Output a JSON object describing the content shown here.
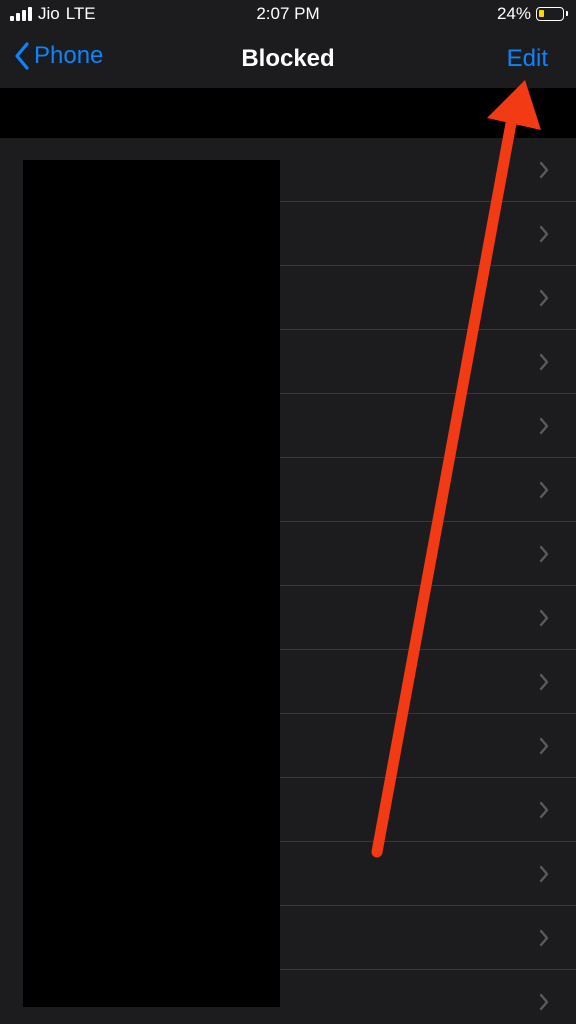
{
  "status_bar": {
    "carrier": "Jio",
    "network": "LTE",
    "time": "2:07 PM",
    "battery_percent": "24%",
    "battery_level": 0.24,
    "battery_color": "#ffd60a"
  },
  "nav": {
    "back_label": "Phone",
    "title": "Blocked",
    "edit_label": "Edit",
    "accent_color": "#0a84ff"
  },
  "list": {
    "rows": [
      {
        "label": ""
      },
      {
        "label": ""
      },
      {
        "label": ""
      },
      {
        "label": ""
      },
      {
        "label": ""
      },
      {
        "label": ""
      },
      {
        "label": ""
      },
      {
        "label": ""
      },
      {
        "label": ""
      },
      {
        "label": ""
      },
      {
        "label": ""
      },
      {
        "label": ""
      },
      {
        "label": ""
      },
      {
        "label": ""
      }
    ]
  },
  "annotation": {
    "arrow_color": "#f23a14"
  }
}
